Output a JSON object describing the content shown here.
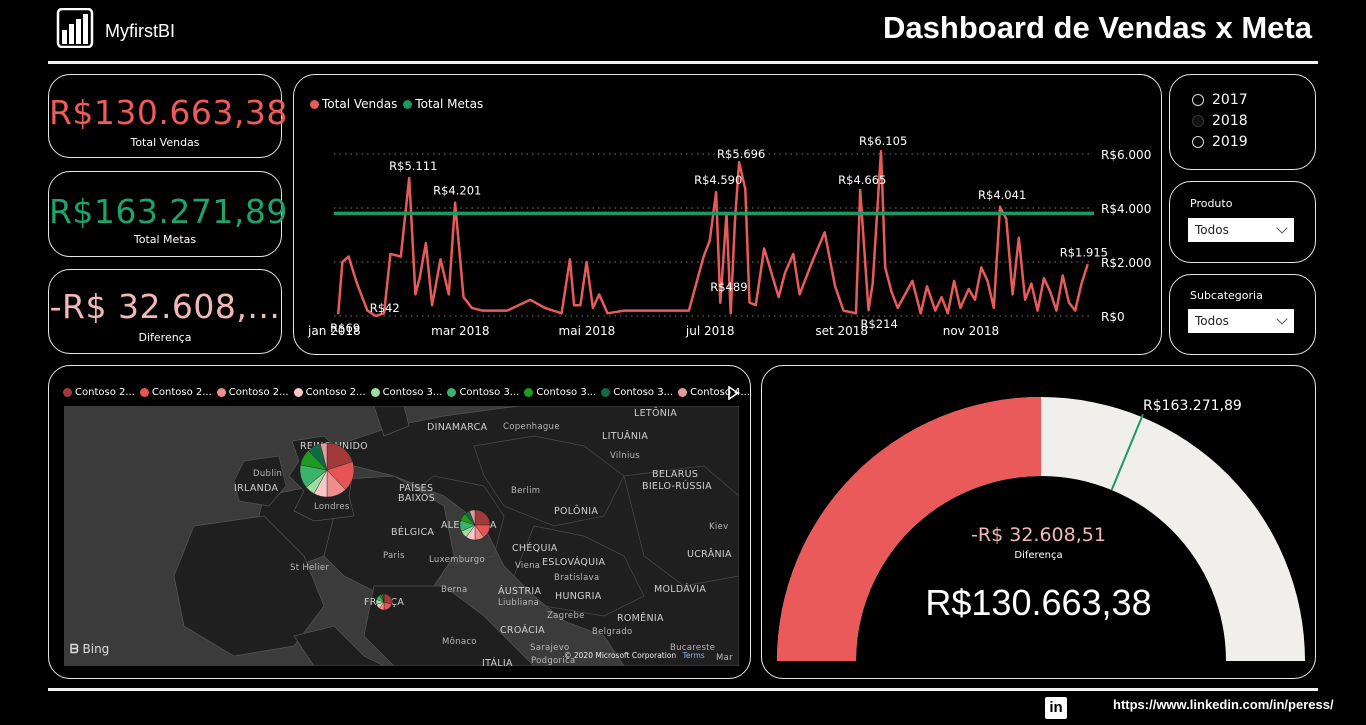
{
  "header": {
    "brand": "MyfirstBI",
    "title": "Dashboard de Vendas x Meta"
  },
  "kpis": [
    {
      "value": "R$130.663,38",
      "label": "Total Vendas",
      "color": "#ef5a5a"
    },
    {
      "value": "R$163.271,89",
      "label": "Total Metas",
      "color": "#1ea36b"
    },
    {
      "value": "-R$ 32.608,...",
      "label": "Diferença",
      "color": "#f2b8b8"
    }
  ],
  "line_chart": {
    "legend": [
      {
        "name": "Total Vendas",
        "color": "#e85b5b"
      },
      {
        "name": "Total Metas",
        "color": "#1a9a62"
      }
    ],
    "x_ticks": [
      "jan 2018",
      "mar 2018",
      "mai 2018",
      "jul 2018",
      "set 2018",
      "nov 2018"
    ],
    "y_ticks": [
      "R$0",
      "R$2.000",
      "R$4.000",
      "R$6.000"
    ],
    "data_labels": [
      "R$69",
      "R$5.111",
      "R$42",
      "R$4.201",
      "R$4.590",
      "R$5.696",
      "R$489",
      "R$4.665",
      "R$6.105",
      "R$214",
      "R$4.041",
      "R$1.915"
    ]
  },
  "chart_data": {
    "type": "line",
    "title": "",
    "xlabel": "",
    "ylabel": "",
    "ylim": [
      0,
      6000
    ],
    "x_range": [
      "2018-01-01",
      "2018-12-31"
    ],
    "grid": true,
    "legend_position": "top-left",
    "series": [
      {
        "name": "Total Vendas",
        "color": "#e85b5b",
        "x": [
          "2018-01-03",
          "2018-01-05",
          "2018-01-08",
          "2018-01-12",
          "2018-01-17",
          "2018-01-21",
          "2018-01-25",
          "2018-01-28",
          "2018-02-02",
          "2018-02-06",
          "2018-02-09",
          "2018-02-11",
          "2018-02-14",
          "2018-02-17",
          "2018-02-21",
          "2018-02-25",
          "2018-02-28",
          "2018-03-04",
          "2018-03-08",
          "2018-03-13",
          "2018-03-18",
          "2018-03-25",
          "2018-04-05",
          "2018-04-12",
          "2018-04-20",
          "2018-04-24",
          "2018-04-26",
          "2018-04-29",
          "2018-05-02",
          "2018-05-05",
          "2018-05-08",
          "2018-05-12",
          "2018-05-20",
          "2018-06-01",
          "2018-06-10",
          "2018-06-20",
          "2018-06-27",
          "2018-06-30",
          "2018-07-03",
          "2018-07-05",
          "2018-07-08",
          "2018-07-10",
          "2018-07-12",
          "2018-07-14",
          "2018-07-17",
          "2018-07-19",
          "2018-07-22",
          "2018-07-26",
          "2018-08-02",
          "2018-08-05",
          "2018-08-09",
          "2018-08-12",
          "2018-08-18",
          "2018-08-24",
          "2018-08-29",
          "2018-09-02",
          "2018-09-08",
          "2018-09-10",
          "2018-09-14",
          "2018-09-16",
          "2018-09-20",
          "2018-09-22",
          "2018-09-25",
          "2018-09-28",
          "2018-10-05",
          "2018-10-09",
          "2018-10-12",
          "2018-10-16",
          "2018-10-19",
          "2018-10-22",
          "2018-10-25",
          "2018-10-28",
          "2018-11-01",
          "2018-11-04",
          "2018-11-07",
          "2018-11-10",
          "2018-11-13",
          "2018-11-16",
          "2018-11-19",
          "2018-11-22",
          "2018-11-25",
          "2018-11-28",
          "2018-12-01",
          "2018-12-04",
          "2018-12-07",
          "2018-12-10",
          "2018-12-13",
          "2018-12-16",
          "2018-12-19",
          "2018-12-22",
          "2018-12-25",
          "2018-12-28"
        ],
        "y": [
          69,
          2000,
          2200,
          1200,
          200,
          0,
          100,
          2300,
          2200,
          5111,
          800,
          1400,
          2700,
          400,
          2100,
          800,
          4201,
          700,
          300,
          200,
          200,
          200,
          600,
          300,
          100,
          2100,
          400,
          400,
          2000,
          300,
          800,
          100,
          200,
          200,
          200,
          200,
          2200,
          2800,
          4590,
          489,
          3800,
          100,
          3500,
          5696,
          4700,
          500,
          400,
          2500,
          700,
          1600,
          2300,
          800,
          2000,
          3100,
          1100,
          200,
          100,
          4665,
          214,
          1200,
          6105,
          1800,
          900,
          300,
          1300,
          100,
          1100,
          200,
          700,
          100,
          1300,
          300,
          1000,
          600,
          1800,
          1300,
          300,
          4041,
          3600,
          800,
          2900,
          600,
          1200,
          200,
          1400,
          900,
          200,
          1500,
          500,
          200,
          1200,
          1915
        ]
      },
      {
        "name": "Total Metas",
        "color": "#1a9a62",
        "x": [
          "2018-01-01",
          "2018-12-31"
        ],
        "y": [
          3800,
          3800
        ]
      }
    ]
  },
  "slicers": {
    "years": [
      {
        "label": "2017",
        "selected": false
      },
      {
        "label": "2018",
        "selected": true
      },
      {
        "label": "2019",
        "selected": false
      }
    ],
    "produto": {
      "title": "Produto",
      "value": "Todos"
    },
    "subcategoria": {
      "title": "Subcategoria",
      "value": "Todos"
    }
  },
  "map": {
    "legend": [
      {
        "name": "Contoso 2...",
        "color": "#a33a3a"
      },
      {
        "name": "Contoso 2...",
        "color": "#e65454"
      },
      {
        "name": "Contoso 2...",
        "color": "#f08d8d"
      },
      {
        "name": "Contoso 2...",
        "color": "#f7c6c6"
      },
      {
        "name": "Contoso 3...",
        "color": "#9fdc9f"
      },
      {
        "name": "Contoso 3...",
        "color": "#3bb36a"
      },
      {
        "name": "Contoso 3...",
        "color": "#1f9a1f"
      },
      {
        "name": "Contoso 3...",
        "color": "#0f6b45"
      },
      {
        "name": "Contoso 4...",
        "color": "#e59b9b"
      }
    ],
    "labels": [
      "LETÔNIA",
      "DINAMARCA",
      "Copenhague",
      "LITUÂNIA",
      "Vilnius",
      "REINO UNIDO",
      "Dublin",
      "IRLANDA",
      "BELARUS",
      "BIELO-RÚSSIA",
      "PAÍSES",
      "BAIXOS",
      "Berlim",
      "Londres",
      "POLÔNIA",
      "ALEMANHA",
      "BÉLGICA",
      "Kiev",
      "CHÉQUIA",
      "Paris",
      "UCRÂNIA",
      "ESLOVÁQUIA",
      "Luxemburgo",
      "St Helier",
      "Viena",
      "Bratislava",
      "ÁUSTRIA",
      "MOLDÁVIA",
      "Berna",
      "HUNGRIA",
      "FRANÇA",
      "Liubliana",
      "Zagrebe",
      "ROMÊNIA",
      "CROÁCIA",
      "Belgrado",
      "Mônaco",
      "Sarajevo",
      "Bucareste",
      "ITÁLIA",
      "Podgorica",
      "Mar"
    ],
    "bing": "Bing",
    "copyright": "© 2020 Microsoft Corporation",
    "terms": "Terms"
  },
  "gauge": {
    "target_label": "R$163.271,89",
    "diff_value": "-R$ 32.608,51",
    "diff_label": "Diferença",
    "main_value": "R$130.663,38",
    "value": 130663.38,
    "target": 163271.89,
    "max": 261327.34,
    "fill_color": "#ea5a5a",
    "track_color": "#f0efec",
    "target_color": "#1a9a62"
  },
  "footer": {
    "linkedin_icon": "in",
    "url": "https://www.linkedin.com/in/peress/"
  }
}
